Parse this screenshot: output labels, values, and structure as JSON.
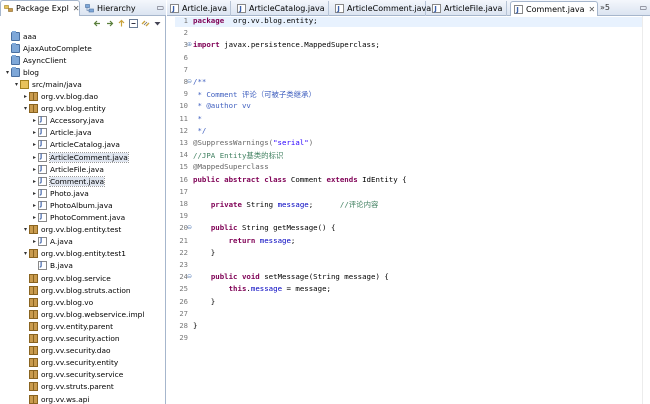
{
  "left_tabs": {
    "active_label": "Package Expl",
    "active_close": "✕",
    "inactive_label": "Hierarchy"
  },
  "tree": [
    {
      "label": "aaa",
      "icon": "project-icon",
      "indent": 1,
      "twisty": ""
    },
    {
      "label": "AjaxAutoComplete",
      "icon": "project-icon",
      "indent": 1,
      "twisty": ""
    },
    {
      "label": "AsyncClient",
      "icon": "project-icon",
      "indent": 1,
      "twisty": ""
    },
    {
      "label": "blog",
      "icon": "project-icon",
      "indent": 1,
      "twisty": "▾"
    },
    {
      "label": "src/main/java",
      "icon": "source-folder-icon",
      "indent": 2,
      "twisty": "▾"
    },
    {
      "label": "org.vv.blog.dao",
      "icon": "package-icon",
      "indent": 3,
      "twisty": "▸"
    },
    {
      "label": "org.vv.blog.entity",
      "icon": "package-icon",
      "indent": 3,
      "twisty": "▾"
    },
    {
      "label": "Accessory.java",
      "icon": "java-file-icon",
      "indent": 4,
      "twisty": "▸"
    },
    {
      "label": "Article.java",
      "icon": "java-file-icon",
      "indent": 4,
      "twisty": "▸"
    },
    {
      "label": "ArticleCatalog.java",
      "icon": "java-file-icon",
      "indent": 4,
      "twisty": "▸"
    },
    {
      "label": "ArticleComment.java",
      "icon": "java-file-icon",
      "indent": 4,
      "twisty": "▸",
      "selected": true
    },
    {
      "label": "ArticleFile.java",
      "icon": "java-file-icon",
      "indent": 4,
      "twisty": "▸"
    },
    {
      "label": "Comment.java",
      "icon": "java-file-icon",
      "indent": 4,
      "twisty": "▸",
      "selected": true
    },
    {
      "label": "Photo.java",
      "icon": "java-file-icon",
      "indent": 4,
      "twisty": "▸"
    },
    {
      "label": "PhotoAlbum.java",
      "icon": "java-file-icon",
      "indent": 4,
      "twisty": "▸"
    },
    {
      "label": "PhotoComment.java",
      "icon": "java-file-icon",
      "indent": 4,
      "twisty": "▸"
    },
    {
      "label": "org.vv.blog.entity.test",
      "icon": "package-icon",
      "indent": 3,
      "twisty": "▾"
    },
    {
      "label": "A.java",
      "icon": "java-file-icon",
      "indent": 4,
      "twisty": "▸"
    },
    {
      "label": "org.vv.blog.entity.test1",
      "icon": "package-icon",
      "indent": 3,
      "twisty": "▾"
    },
    {
      "label": "B.java",
      "icon": "java-file-icon",
      "indent": 4,
      "twisty": ""
    },
    {
      "label": "org.vv.blog.service",
      "icon": "package-icon",
      "indent": 3,
      "twisty": ""
    },
    {
      "label": "org.vv.blog.struts.action",
      "icon": "package-icon",
      "indent": 3,
      "twisty": ""
    },
    {
      "label": "org.vv.blog.vo",
      "icon": "package-icon",
      "indent": 3,
      "twisty": ""
    },
    {
      "label": "org.vv.blog.webservice.impl",
      "icon": "package-icon",
      "indent": 3,
      "twisty": ""
    },
    {
      "label": "org.vv.entity.parent",
      "icon": "package-icon",
      "indent": 3,
      "twisty": ""
    },
    {
      "label": "org.vv.security.action",
      "icon": "package-icon",
      "indent": 3,
      "twisty": ""
    },
    {
      "label": "org.vv.security.dao",
      "icon": "package-icon",
      "indent": 3,
      "twisty": ""
    },
    {
      "label": "org.vv.security.entity",
      "icon": "package-icon",
      "indent": 3,
      "twisty": ""
    },
    {
      "label": "org.vv.security.service",
      "icon": "package-icon",
      "indent": 3,
      "twisty": ""
    },
    {
      "label": "org.vv.struts.parent",
      "icon": "package-icon",
      "indent": 3,
      "twisty": ""
    },
    {
      "label": "org.vv.ws.api",
      "icon": "package-icon",
      "indent": 3,
      "twisty": ""
    }
  ],
  "editor_tabs": [
    {
      "label": "Article.java",
      "active": false
    },
    {
      "label": "ArticleCatalog.java",
      "active": false
    },
    {
      "label": "ArticleComment.java",
      "active": false
    },
    {
      "label": "ArticleFile.java",
      "active": false
    },
    {
      "label": "Comment.java",
      "active": true,
      "close": "✕"
    }
  ],
  "editor_overflow": "»5",
  "code_lines": [
    {
      "n": "1",
      "parts": [
        [
          "kw",
          "package"
        ],
        [
          "",
          "  org.vv.blog.entity;"
        ]
      ]
    },
    {
      "n": "2",
      "parts": []
    },
    {
      "n": "3",
      "fold": "⊕",
      "parts": [
        [
          "kw",
          "import"
        ],
        [
          "",
          " javax.persistence.MappedSuperclass;"
        ]
      ]
    },
    {
      "n": "6",
      "parts": []
    },
    {
      "n": "7",
      "parts": []
    },
    {
      "n": "8",
      "fold": "⊖",
      "parts": [
        [
          "dc",
          "/**"
        ]
      ]
    },
    {
      "n": "9",
      "parts": [
        [
          "dc",
          " * Comment 评论（可被子类继承）"
        ]
      ]
    },
    {
      "n": "10",
      "parts": [
        [
          "dc",
          " * @author vv"
        ]
      ]
    },
    {
      "n": "11",
      "parts": [
        [
          "dc",
          " *"
        ]
      ]
    },
    {
      "n": "12",
      "parts": [
        [
          "dc",
          " */"
        ]
      ]
    },
    {
      "n": "13",
      "parts": [
        [
          "an",
          "@SuppressWarnings("
        ],
        [
          "st",
          "\"serial\""
        ],
        [
          "an",
          ")"
        ]
      ]
    },
    {
      "n": "14",
      "parts": [
        [
          "cm",
          "//JPA Entity基类的标识"
        ]
      ]
    },
    {
      "n": "15",
      "parts": [
        [
          "an",
          "@MappedSuperclass"
        ]
      ]
    },
    {
      "n": "16",
      "parts": [
        [
          "kw",
          "public abstract class"
        ],
        [
          "",
          " Comment "
        ],
        [
          "kw",
          "extends"
        ],
        [
          "",
          " IdEntity {"
        ]
      ]
    },
    {
      "n": "17",
      "parts": []
    },
    {
      "n": "18",
      "parts": [
        [
          "",
          "    "
        ],
        [
          "kw",
          "private"
        ],
        [
          "",
          " String "
        ],
        [
          "fd",
          "message"
        ],
        [
          "",
          ";      "
        ],
        [
          "cm",
          "//评论内容"
        ]
      ]
    },
    {
      "n": "19",
      "parts": []
    },
    {
      "n": "20",
      "fold": "⊖",
      "parts": [
        [
          "",
          "    "
        ],
        [
          "kw",
          "public"
        ],
        [
          "",
          " String getMessage() {"
        ]
      ]
    },
    {
      "n": "21",
      "parts": [
        [
          "",
          "        "
        ],
        [
          "kw",
          "return"
        ],
        [
          "",
          " "
        ],
        [
          "fd",
          "message"
        ],
        [
          "",
          ";"
        ]
      ]
    },
    {
      "n": "22",
      "parts": [
        [
          "",
          "    }"
        ]
      ]
    },
    {
      "n": "23",
      "parts": []
    },
    {
      "n": "24",
      "fold": "⊖",
      "parts": [
        [
          "",
          "    "
        ],
        [
          "kw",
          "public void"
        ],
        [
          "",
          " setMessage(String message) {"
        ]
      ]
    },
    {
      "n": "25",
      "parts": [
        [
          "",
          "        "
        ],
        [
          "kw",
          "this"
        ],
        [
          ".",
          ""
        ],
        [
          "fd",
          "message"
        ],
        [
          "",
          " = message;"
        ]
      ]
    },
    {
      "n": "26",
      "parts": [
        [
          "",
          "    }"
        ]
      ]
    },
    {
      "n": "27",
      "parts": []
    },
    {
      "n": "28",
      "parts": [
        [
          "",
          "}"
        ]
      ]
    },
    {
      "n": "29",
      "parts": []
    }
  ],
  "colors": {
    "keyword": "#7f0055",
    "comment": "#3f7f5f",
    "javadoc": "#3f5fbf",
    "string": "#2a00ff",
    "field": "#0000c0",
    "tab_border": "#a6b6cc"
  }
}
